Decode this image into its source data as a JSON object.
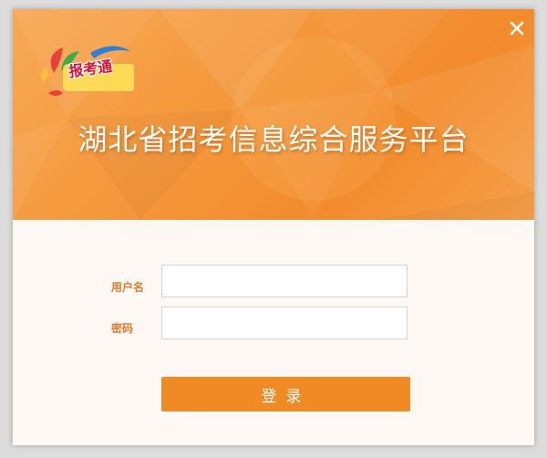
{
  "header": {
    "logo_text": "报考通",
    "title": "湖北省招考信息综合服务平台",
    "close_icon": "close-icon"
  },
  "form": {
    "username_label": "用户名",
    "username_value": "",
    "password_label": "密码",
    "password_value": "",
    "login_label": "登录"
  },
  "colors": {
    "header_orange": "#f59a3f",
    "accent_orange": "#f08a24",
    "label_orange": "#e07a2c",
    "body_bg": "#fdf8f4"
  }
}
